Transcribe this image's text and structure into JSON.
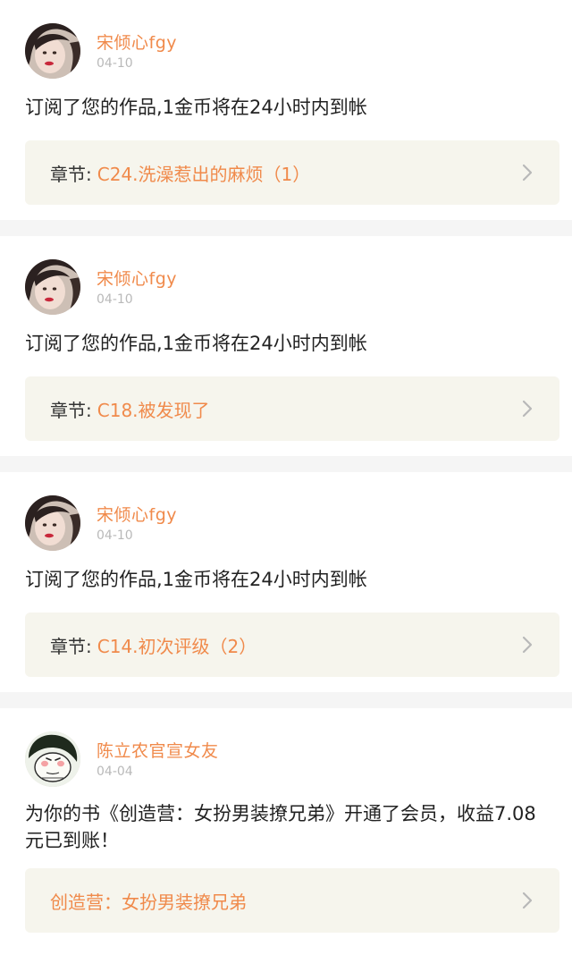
{
  "feed": [
    {
      "user": "宋倾心fgy",
      "date": "04-10",
      "message": "订阅了您的作品,1金币将在24小时内到帐",
      "chapter_label": "章节:",
      "chapter_title": "C24.洗澡惹出的麻烦（1）"
    },
    {
      "user": "宋倾心fgy",
      "date": "04-10",
      "message": "订阅了您的作品,1金币将在24小时内到帐",
      "chapter_label": "章节:",
      "chapter_title": "C18.被发现了"
    },
    {
      "user": "宋倾心fgy",
      "date": "04-10",
      "message": "订阅了您的作品,1金币将在24小时内到帐",
      "chapter_label": "章节:",
      "chapter_title": "C14.初次评级（2）"
    },
    {
      "user": "陈立农官宣女友",
      "date": "04-04",
      "message": "为你的书《创造营：女扮男装撩兄弟》开通了会员，收益7.08元已到账！",
      "book_title": "创造营：女扮男装撩兄弟"
    }
  ],
  "colors": {
    "accent": "#f08a4b",
    "panel": "#f6f5ed",
    "date": "#b9b9b9",
    "separator": "#f5f5f5"
  },
  "icons": {
    "avatar_1": "girl-avatar",
    "avatar_4": "cartoon-avatar",
    "chevron": "chevron-right-icon"
  }
}
